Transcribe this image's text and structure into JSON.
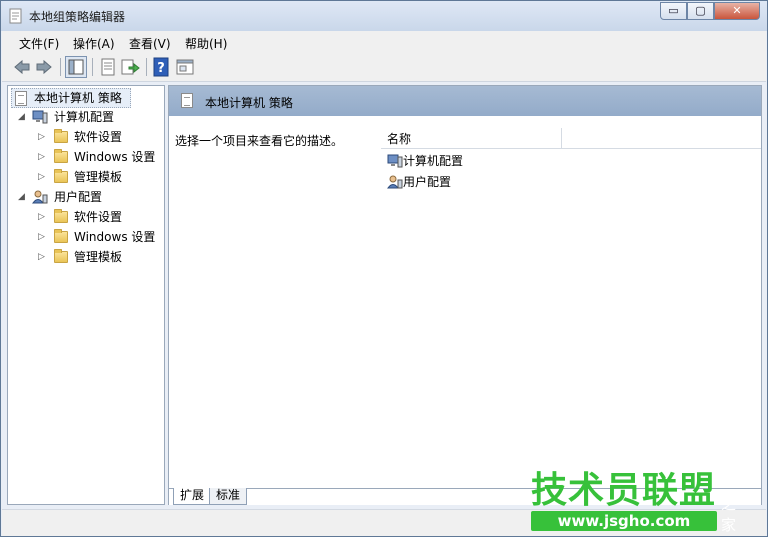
{
  "window": {
    "title": "本地组策略编辑器"
  },
  "controls": {
    "minimize": "▭",
    "maximize": "▢",
    "close": "✕"
  },
  "menu": [
    {
      "label": "文件(F)"
    },
    {
      "label": "操作(A)"
    },
    {
      "label": "查看(V)"
    },
    {
      "label": "帮助(H)"
    }
  ],
  "tree": {
    "root": "本地计算机 策略",
    "computer": "计算机配置",
    "computer_children": [
      "软件设置",
      "Windows 设置",
      "管理模板"
    ],
    "user": "用户配置",
    "user_children": [
      "软件设置",
      "Windows 设置",
      "管理模板"
    ]
  },
  "main": {
    "header": "本地计算机 策略",
    "description": "选择一个项目来查看它的描述。",
    "column_name": "名称",
    "rows": [
      "计算机配置",
      "用户配置"
    ]
  },
  "tabs": [
    "扩展",
    "标准"
  ],
  "watermark": {
    "title": "技术员联盟",
    "url": "www.jsgho.com",
    "side": "之家"
  },
  "colors": {
    "accent": "#93abc9",
    "watermark": "#37c13a"
  }
}
